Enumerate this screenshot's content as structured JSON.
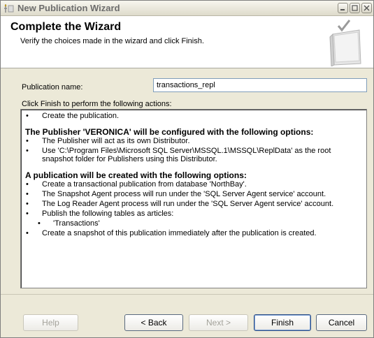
{
  "window": {
    "title": "New Publication Wizard"
  },
  "header": {
    "title": "Complete the Wizard",
    "subtitle": "Verify the choices made in the wizard and click Finish."
  },
  "form": {
    "publication_name_label": "Publication name:",
    "publication_name_value": "transactions_repl",
    "actions_label": "Click Finish to perform the following actions:"
  },
  "actions": {
    "item1": "Create the publication.",
    "section1": "The Publisher 'VERONICA' will be configured with the following options:",
    "s1_item1": "The Publisher will act as its own Distributor.",
    "s1_item2": "Use 'C:\\Program Files\\Microsoft SQL Server\\MSSQL.1\\MSSQL\\ReplData' as the root snapshot folder for Publishers using this Distributor.",
    "section2": "A publication will be created with the following options:",
    "s2_item1": "Create a transactional publication from database 'NorthBay'.",
    "s2_item2": "The Snapshot Agent process will run under the 'SQL Server Agent service' account.",
    "s2_item3": "The Log Reader Agent process will run under the 'SQL Server Agent service' account.",
    "s2_item4": "Publish the following tables as articles:",
    "s2_item4_sub": "'Transactions'",
    "s2_item5": "Create a snapshot of this publication immediately after the publication is created."
  },
  "buttons": {
    "help": "Help",
    "back": "< Back",
    "next": "Next >",
    "finish": "Finish",
    "cancel": "Cancel"
  }
}
